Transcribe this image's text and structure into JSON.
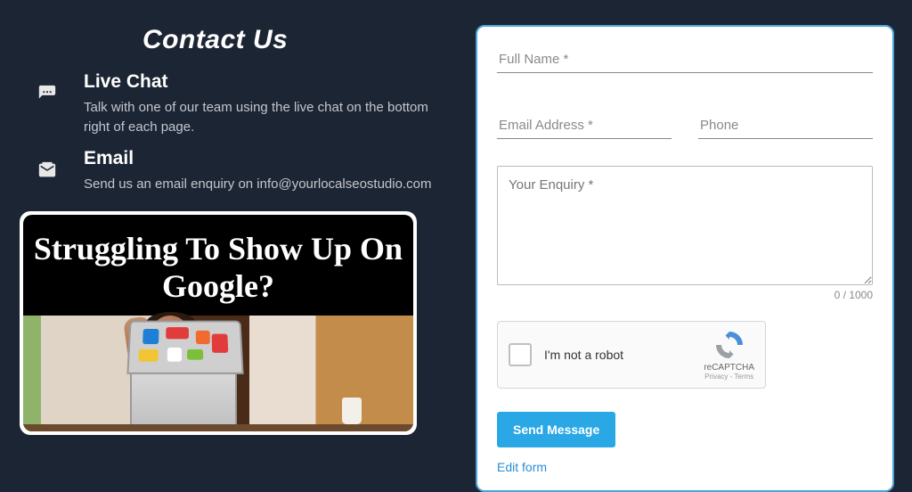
{
  "pageTitle": "Contact Us",
  "contacts": {
    "liveChat": {
      "heading": "Live Chat",
      "body": "Talk with one of our team using the live chat on the bottom right of each page."
    },
    "email": {
      "heading": "Email",
      "body": "Send us an email enquiry on info@yourlocalseostudio.com"
    }
  },
  "promo": {
    "headline": "Struggling To Show Up On Google?"
  },
  "form": {
    "fullNamePlaceholder": "Full Name *",
    "emailPlaceholder": "Email Address *",
    "phonePlaceholder": "Phone",
    "enquiryPlaceholder": "Your Enquiry *",
    "charCount": "0 / 1000",
    "recaptchaLabel": "I'm not a robot",
    "recaptchaBrand": "reCAPTCHA",
    "recaptchaLinks": "Privacy - Terms",
    "sendLabel": "Send Message",
    "editFormLabel": "Edit form"
  }
}
